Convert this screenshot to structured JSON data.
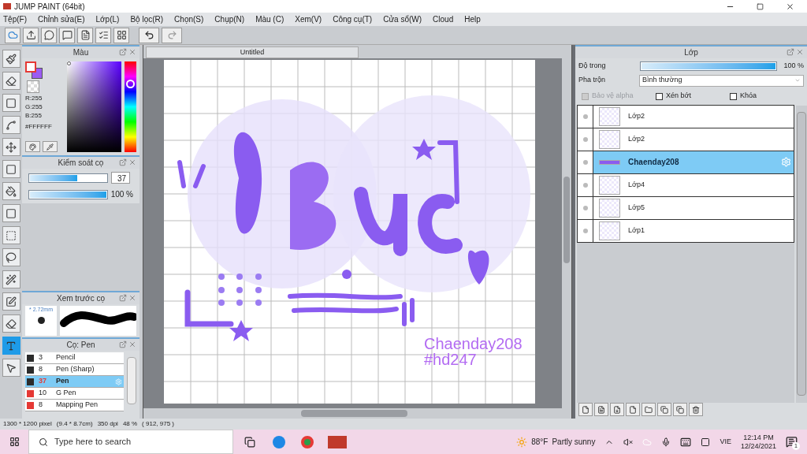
{
  "window": {
    "title": "JUMP PAINT (64bit)"
  },
  "menu": [
    "Tệp(F)",
    "Chỉnh sửa(E)",
    "Lớp(L)",
    "Bộ lọc(R)",
    "Chọn(S)",
    "Chụp(N)",
    "Màu (C)",
    "Xem(V)",
    "Công cụ(T)",
    "Cửa sổ(W)",
    "Cloud",
    "Help"
  ],
  "tools": [
    {
      "kind": "brush",
      "selected": false
    },
    {
      "kind": "eraser",
      "selected": false
    },
    {
      "kind": "square",
      "selected": false
    },
    {
      "kind": "dots",
      "selected": false
    },
    {
      "kind": "move",
      "selected": false
    },
    {
      "kind": "fill-square",
      "selected": false
    },
    {
      "kind": "bucket",
      "selected": false
    },
    {
      "kind": "gradient",
      "selected": false
    },
    {
      "kind": "select",
      "selected": false
    },
    {
      "kind": "lasso",
      "selected": false
    },
    {
      "kind": "wand",
      "selected": false
    },
    {
      "kind": "select-pen",
      "selected": false
    },
    {
      "kind": "select-eraser",
      "selected": false
    },
    {
      "kind": "text",
      "selected": true
    },
    {
      "kind": "pointer",
      "selected": false
    }
  ],
  "color_panel": {
    "title": "Màu",
    "readings": [
      "R:255",
      "G:255",
      "B:255"
    ],
    "hex": "#FFFFFF"
  },
  "brush_control": {
    "title": "Kiểm soát cọ",
    "size_slider": {
      "level": 0.62
    },
    "size": "37",
    "opacity_slider": {
      "level": 1
    },
    "opacity": "100 %"
  },
  "brush_preview": {
    "title": "Xem trước cọ",
    "size": "* 2.72mm"
  },
  "brush_list": {
    "title": "Cọ: Pen",
    "items": [
      {
        "size": "3",
        "name": "Pencil",
        "color": "#2b2b2b",
        "selected": false
      },
      {
        "size": "8",
        "name": "Pen (Sharp)",
        "color": "#2b2b2b",
        "selected": false
      },
      {
        "size": "37",
        "name": "Pen",
        "color": "#2b2b2b",
        "selected": true
      },
      {
        "size": "10",
        "name": "G Pen",
        "color": "#e53935",
        "selected": false
      },
      {
        "size": "8",
        "name": "Mapping Pen",
        "color": "#e53935",
        "selected": false
      }
    ]
  },
  "document": {
    "tab": "Untitled",
    "texts": [
      "Chaenday208",
      "#hd247"
    ]
  },
  "layers_panel": {
    "title": "Lớp",
    "opacity_label": "Độ trong",
    "opacity_slider": {
      "level": 1
    },
    "opacity": "100 %",
    "blend_label": "Pha trộn",
    "blend": "Bình thường",
    "options": [
      {
        "label": "Bảo vệ alpha",
        "checked": false,
        "disabled": true
      },
      {
        "label": "Xén bớt",
        "checked": false,
        "disabled": false
      },
      {
        "label": "Khóa",
        "checked": false,
        "disabled": false
      }
    ],
    "layers": [
      {
        "name": "Lớp2",
        "selected": false
      },
      {
        "name": "Lớp2",
        "selected": false
      },
      {
        "name": "Chaenday208",
        "selected": true
      },
      {
        "name": "Lớp4",
        "selected": false
      },
      {
        "name": "Lớp5",
        "selected": false
      },
      {
        "name": "Lớp1",
        "selected": false
      }
    ]
  },
  "status_bar": [
    "1300 * 1200 pixel",
    "(9.4 * 8.7cm)",
    "350 dpi",
    "48 %",
    "( 912, 975 )"
  ],
  "taskbar": {
    "search": {
      "placeholder": "Type here to search"
    },
    "temperature": "88°F",
    "weather": "Partly sunny",
    "language": "VIE",
    "time": "12:14 PM",
    "date": "12/24/2021",
    "notifications": "1"
  }
}
